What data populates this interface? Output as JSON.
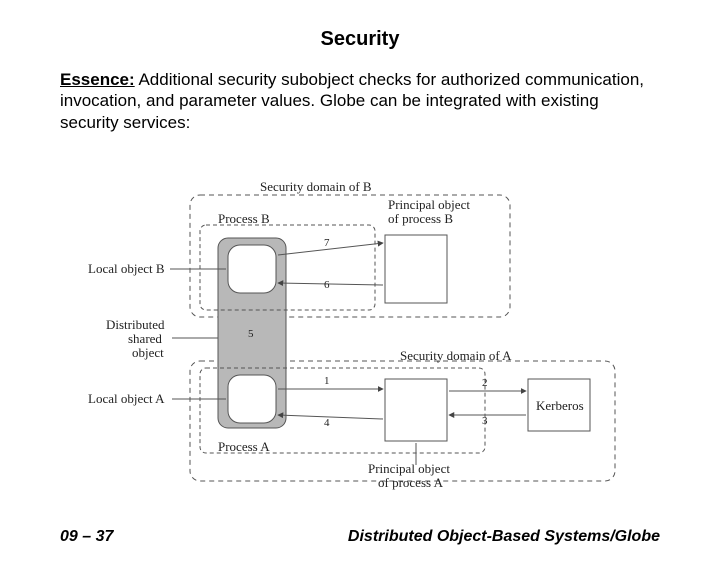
{
  "title": "Security",
  "essence": {
    "label": "Essence:",
    "text": "Additional security subobject checks for authorized communication, invocation, and parameter values. Globe can be integrated with existing security services:"
  },
  "diagram": {
    "sec_domain_b": "Security domain of B",
    "principal_b_1": "Principal object",
    "principal_b_2": "of process B",
    "process_b": "Process B",
    "local_obj_b": "Local object B",
    "distributed_1": "Distributed",
    "distributed_2": "shared",
    "distributed_3": "object",
    "local_obj_a": "Local object A",
    "process_a": "Process A",
    "sec_domain_a": "Security domain of A",
    "kerberos": "Kerberos",
    "principal_a_1": "Principal object",
    "principal_a_2": "of process A",
    "n1": "1",
    "n2": "2",
    "n3": "3",
    "n4": "4",
    "n5": "5",
    "n6": "6",
    "n7": "7"
  },
  "footer": {
    "left": "09 – 37",
    "right": "Distributed Object-Based Systems/Globe"
  }
}
